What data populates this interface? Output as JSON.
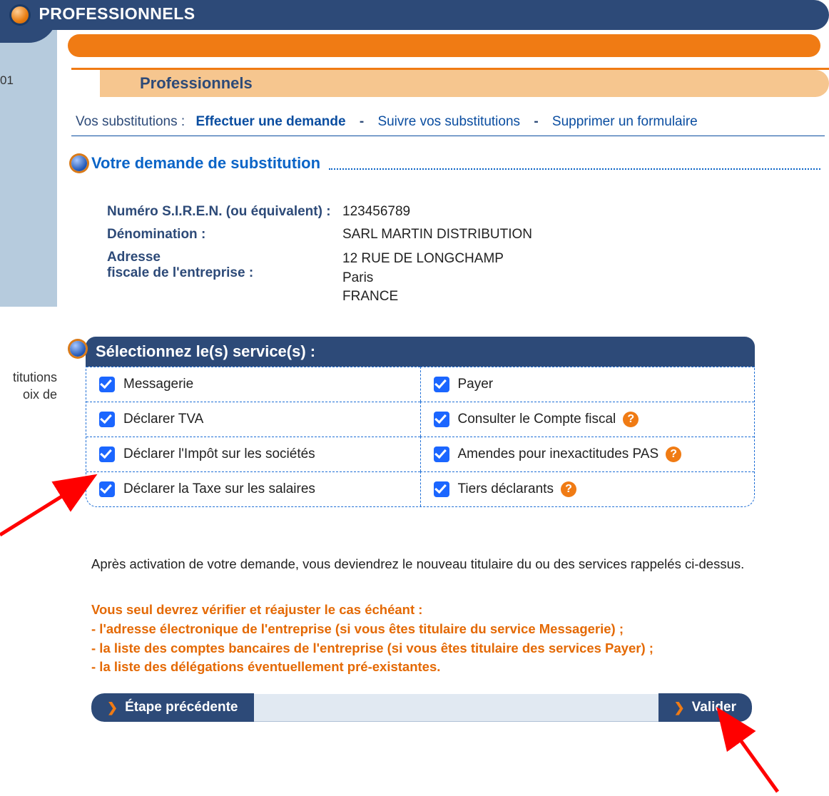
{
  "header": {
    "title": "PROFESSIONNELS"
  },
  "sidebar": {
    "num": "01",
    "text1": "titutions",
    "text2": "oix de"
  },
  "subband": {
    "label": "Professionnels"
  },
  "tabs": {
    "lead": "Vos substitutions :",
    "items": [
      {
        "label": "Effectuer une demande",
        "active": true
      },
      {
        "label": "Suivre vos substitutions",
        "active": false
      },
      {
        "label": "Supprimer un formulaire",
        "active": false
      }
    ]
  },
  "section": {
    "title": "Votre demande de substitution"
  },
  "company": {
    "siren_label": "Numéro S.I.R.E.N. (ou équivalent) :",
    "siren_value": "123456789",
    "name_label": "Dénomination :",
    "name_value": "SARL MARTIN DISTRIBUTION",
    "addr_label_l1": "Adresse",
    "addr_label_l2": "fiscale de l'entreprise :",
    "addr_l1": "12 RUE DE LONGCHAMP",
    "addr_l2": "Paris",
    "addr_l3": "FRANCE"
  },
  "services": {
    "title": "Sélectionnez  le(s) service(s) :",
    "left": [
      {
        "label": "Messagerie",
        "checked": true,
        "help": false
      },
      {
        "label": "Déclarer TVA",
        "checked": true,
        "help": false
      },
      {
        "label": "Déclarer l'Impôt sur les sociétés",
        "checked": true,
        "help": false
      },
      {
        "label": "Déclarer la Taxe sur les salaires",
        "checked": true,
        "help": false
      }
    ],
    "right": [
      {
        "label": "Payer",
        "checked": true,
        "help": false
      },
      {
        "label": "Consulter le Compte fiscal",
        "checked": true,
        "help": true
      },
      {
        "label": "Amendes pour inexactitudes PAS",
        "checked": true,
        "help": true
      },
      {
        "label": "Tiers déclarants",
        "checked": true,
        "help": true
      }
    ],
    "help_glyph": "?"
  },
  "explain": "Après activation de votre demande, vous deviendrez le nouveau titulaire du ou des services rappelés ci-dessus.",
  "warning": {
    "l1": "Vous seul devrez vérifier et réajuster le cas échéant :",
    "l2": "- l'adresse électronique de l'entreprise (si vous êtes titulaire du service Messagerie) ;",
    "l3": "- la liste des comptes bancaires de l'entreprise (si vous êtes titulaire des services Payer) ;",
    "l4": "- la liste des délégations éventuellement pré-existantes."
  },
  "buttons": {
    "prev": "Étape précédente",
    "next": "Valider"
  }
}
